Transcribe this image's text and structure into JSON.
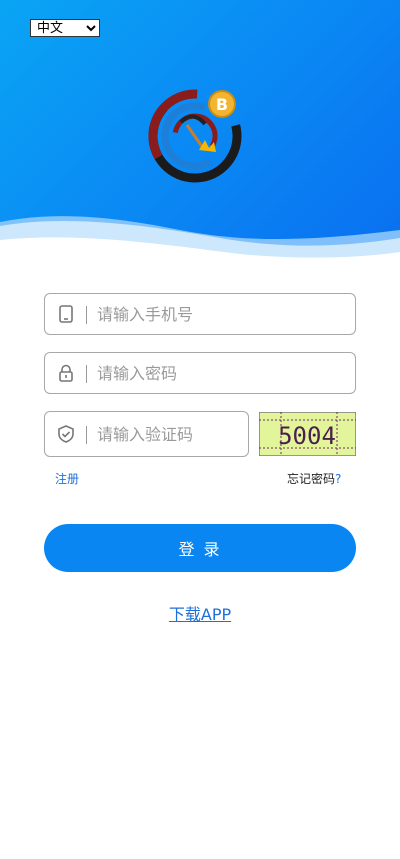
{
  "language": {
    "selected": "中文"
  },
  "form": {
    "phone_placeholder": "请输入手机号",
    "password_placeholder": "请输入密码",
    "code_placeholder": "请输入验证码",
    "captcha_text": "5004"
  },
  "links": {
    "register": "注册",
    "forgot_text": "忘记密码",
    "forgot_mark": "?"
  },
  "login_button": "登 录",
  "download_link": "下载APP",
  "colors": {
    "brand": "#0a86f3",
    "link": "#1e6fd9",
    "hero_start": "#0aa5f4",
    "hero_end": "#0a6ff0"
  },
  "icons": {
    "phone": "mobile-phone-icon",
    "password": "padlock-icon",
    "code": "shield-check-icon",
    "logo": "bitcoin-mining-logo"
  }
}
